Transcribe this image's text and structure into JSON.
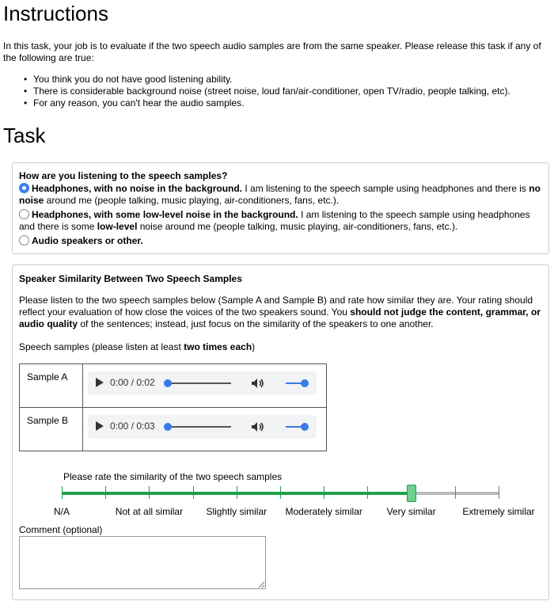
{
  "instructions": {
    "heading": "Instructions",
    "intro": "In this task, your job is to evaluate if the two speech audio samples are from the same speaker. Please release this task if any of the following are true:",
    "bullets": [
      "You think you do not have good listening ability.",
      "There is considerable background noise (street noise, loud fan/air-conditioner, open TV/radio, people talking, etc).",
      "For any reason, you can't hear the audio samples."
    ]
  },
  "task": {
    "heading": "Task",
    "listening": {
      "question": "How are you listening to the speech samples?",
      "options": [
        {
          "bold": "Headphones, with no noise in the background.",
          "text1": " I am listening to the speech sample using headphones and there is ",
          "bold2": "no noise",
          "text2": " around me (people talking, music playing, air-conditioners, fans, etc.).",
          "selected": true
        },
        {
          "bold": "Headphones, with some low-level noise in the background.",
          "text1": " I am listening to the speech sample using headphones and there is some ",
          "bold2": "low-level",
          "text2": " noise around me (people talking, music playing, air-conditioners, fans, etc.).",
          "selected": false
        },
        {
          "bold": "Audio speakers or other.",
          "text1": "",
          "bold2": "",
          "text2": "",
          "selected": false
        }
      ]
    },
    "similarity": {
      "title": "Speaker Similarity Between Two Speech Samples",
      "desc_pre": "Please listen to the two speech samples below (Sample A and Sample B) and rate how similar they are. Your rating should reflect your evaluation of how close the voices of the two speakers sound. You ",
      "desc_bold": "should not judge the content, grammar, or audio quality",
      "desc_post": " of the sentences; instead, just focus on the similarity of the speakers to one another.",
      "samples_pre": "Speech samples (please listen at least ",
      "samples_bold": "two times each",
      "samples_post": ")",
      "samples": [
        {
          "label": "Sample A",
          "time": "0:00 / 0:02"
        },
        {
          "label": "Sample B",
          "time": "0:00 / 0:03"
        }
      ],
      "rate_prompt": "Please rate the similarity of the two speech samples",
      "scale_labels": [
        "N/A",
        "Not at all similar",
        "Slightly similar",
        "Moderately similar",
        "Very similar",
        "Extremely similar"
      ],
      "rating_value": 4,
      "slider_fill_color": "#1ea04c",
      "comment_label": "Comment (optional)",
      "comment_value": ""
    }
  }
}
